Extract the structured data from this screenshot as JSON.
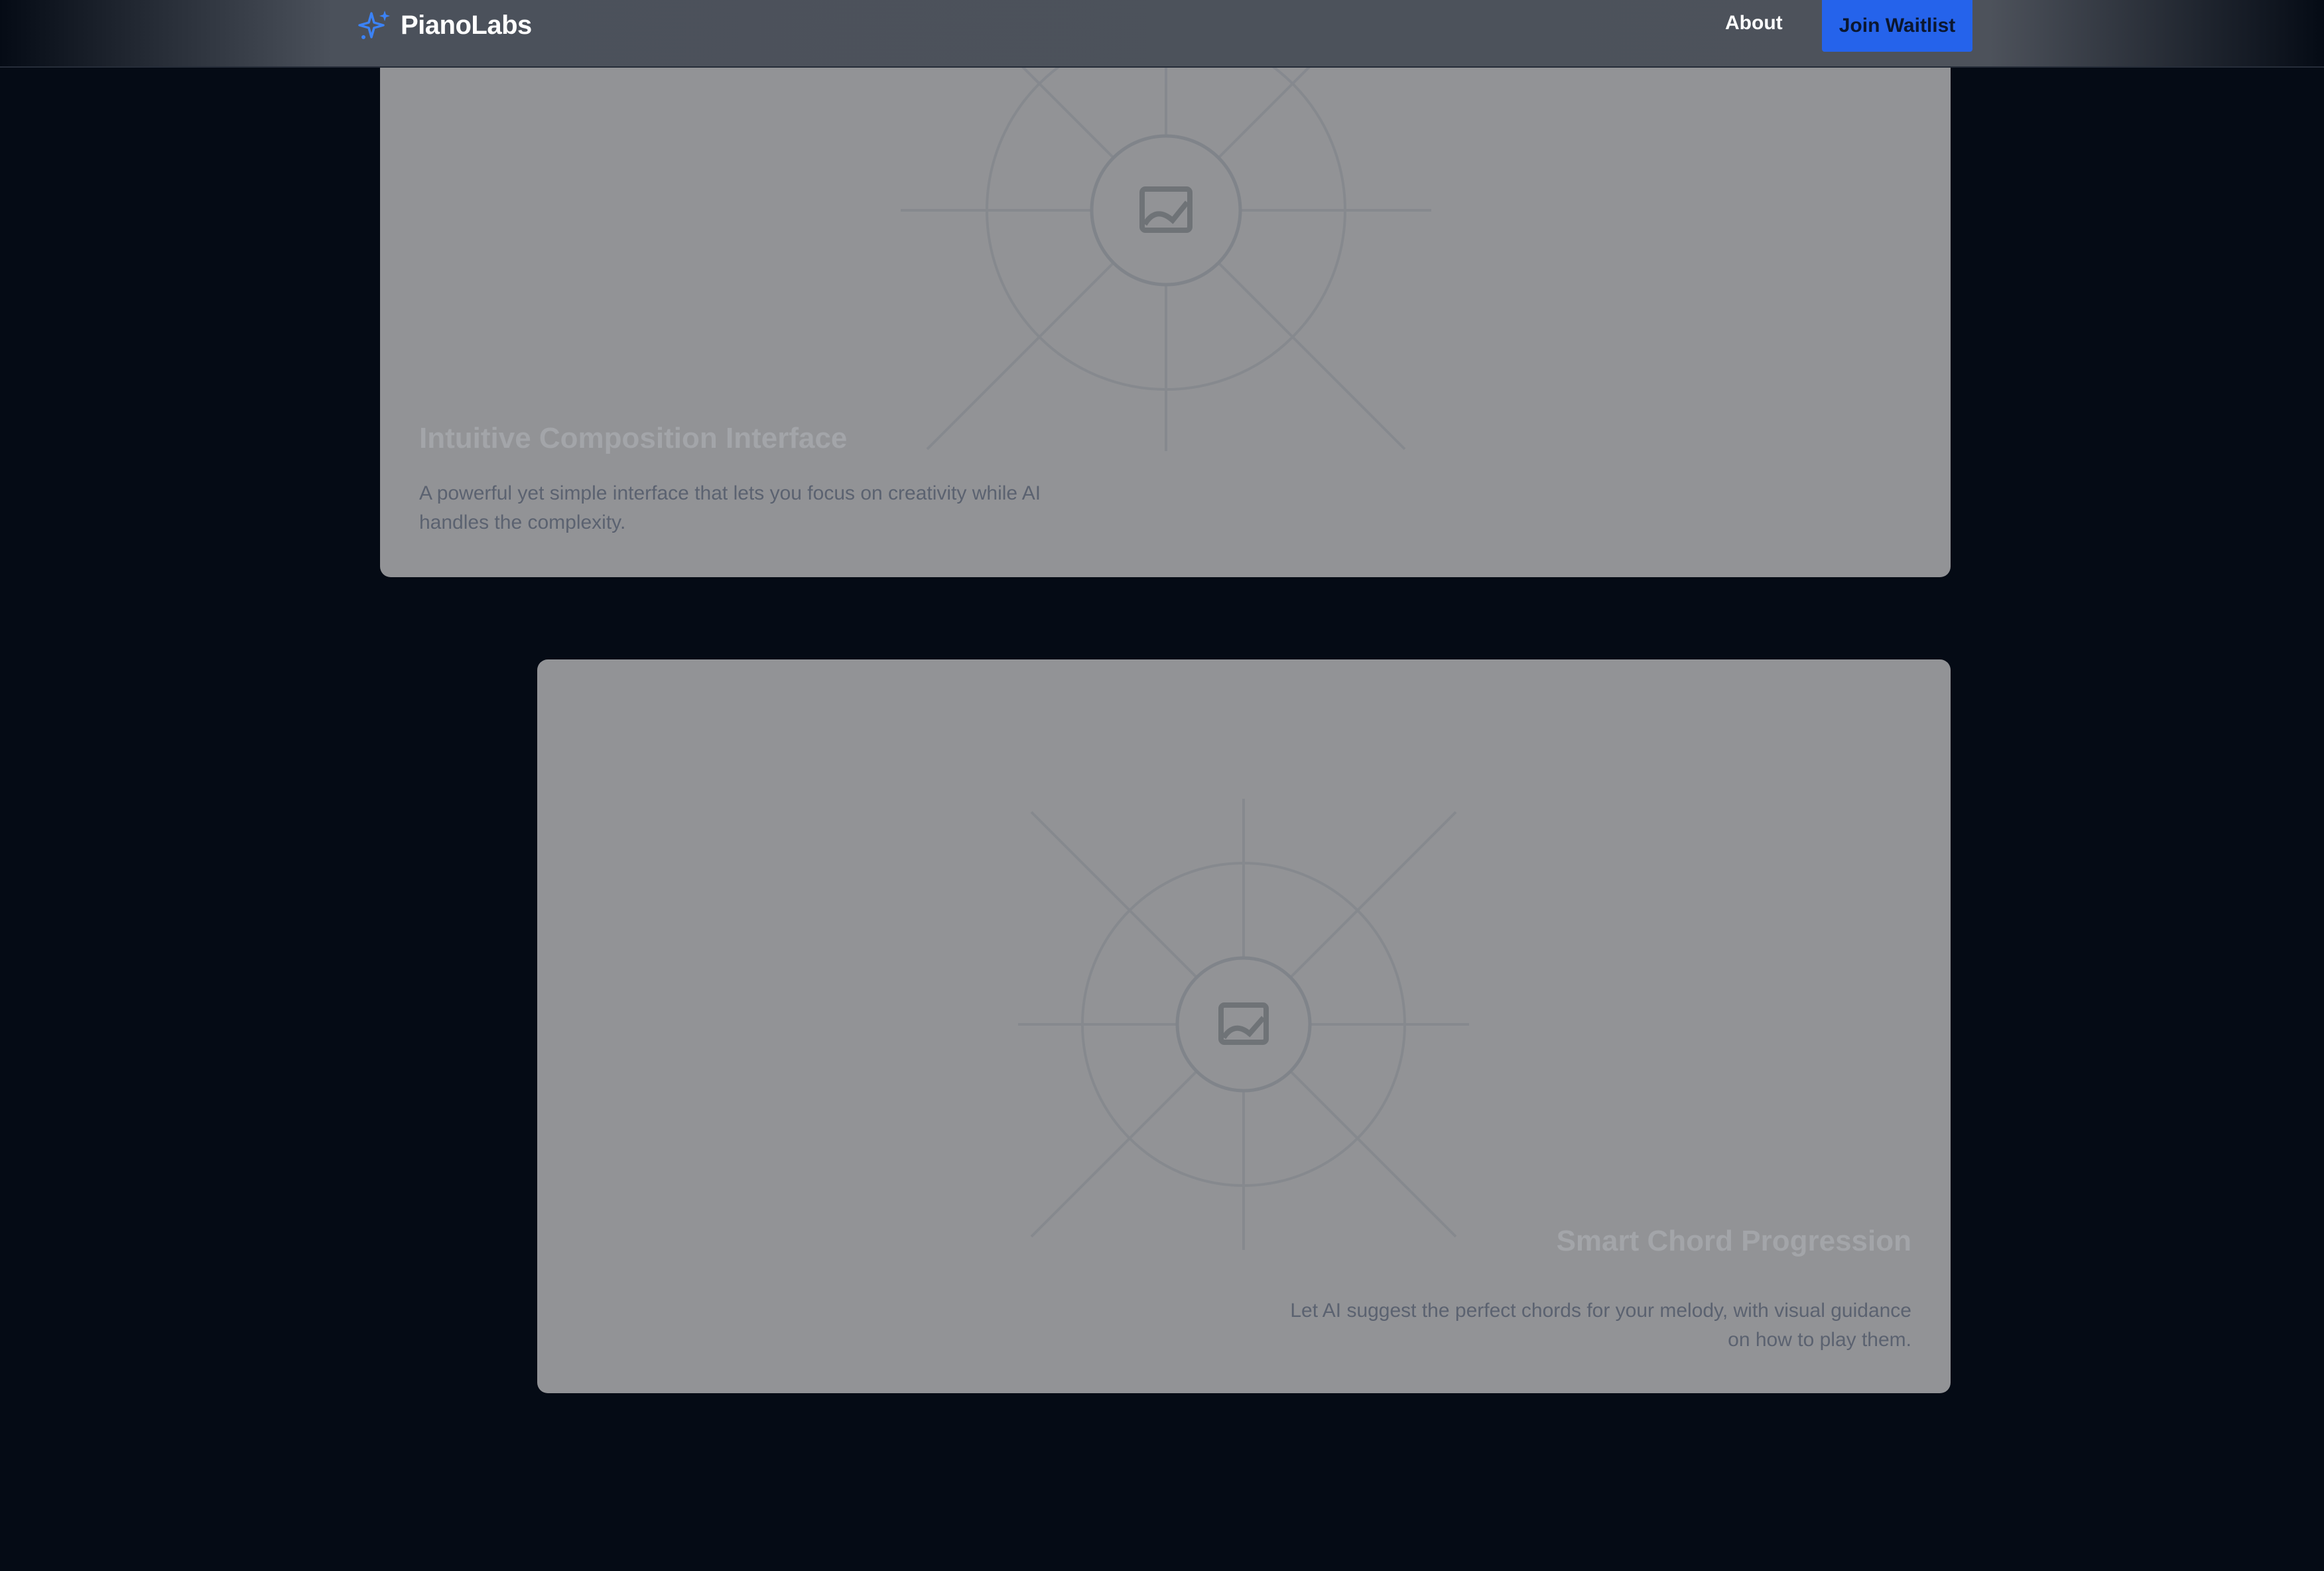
{
  "header": {
    "brand": "PianoLabs",
    "logo_icon": "sparkles-icon",
    "nav_about": "About",
    "cta_label": "Join Waitlist",
    "accent_color": "#2563eb"
  },
  "features": [
    {
      "title": "Intuitive Composition Interface",
      "description": "A powerful yet simple interface that lets you focus on creativity while AI handles the complexity.",
      "image_icon": "image-placeholder-icon"
    },
    {
      "title": "Smart Chord Progression",
      "description": "Let AI suggest the perfect chords for your melody, with visual guidance on how to play them.",
      "image_icon": "image-placeholder-icon"
    }
  ],
  "colors": {
    "background": "#050b15",
    "card": "#929396",
    "title_text": "#a3a5a9",
    "desc_text": "#5b6270"
  }
}
